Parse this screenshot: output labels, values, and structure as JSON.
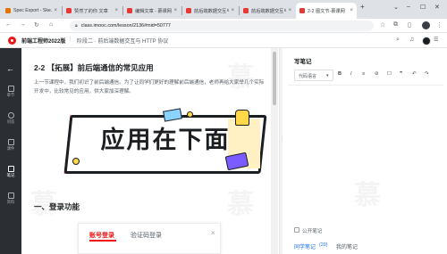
{
  "tabs": [
    {
      "title": "Spec Export - Ske…",
      "active": false,
      "favicon_color": "#e37400"
    },
    {
      "title": "赞然了的你 文章",
      "active": false,
      "favicon_color": "#e53935"
    },
    {
      "title": "编辑文章 - 慕课网",
      "active": false,
      "favicon_color": "#e53935"
    },
    {
      "title": "前后端数据交互与",
      "active": false,
      "favicon_color": "#e53935"
    },
    {
      "title": "前后端数据交互与",
      "active": false,
      "favicon_color": "#e53935"
    },
    {
      "title": "2-2 图文节-慕课网",
      "active": true,
      "favicon_color": "#e53935"
    }
  ],
  "address": {
    "url": "class.imooc.com/lesson/2136#mid=50777"
  },
  "crumbs": {
    "course": "前端工程师2022版",
    "sep": "|",
    "stage": "阶段二 · 前后端数据交互与 HTTP 协议"
  },
  "rail": [
    {
      "label": "章节",
      "icon": "list-icon"
    },
    {
      "label": "问答",
      "icon": "question-icon"
    },
    {
      "label": "课件",
      "icon": "file-icon"
    },
    {
      "label": "笔记",
      "icon": "edit-icon",
      "selected": true
    },
    {
      "label": "资料",
      "icon": "folder-icon"
    }
  ],
  "article": {
    "heading": "2-2 【拓展】前后端通信的常见应用",
    "paragraph": "上一节课程中，我们初识了前后端通信。为了让同学们更好的理解前后端通信，老师再给大家举几个实际开发中，比较常见的应用。供大家加深理解。",
    "banner_text": "应用在下面",
    "section1": "一、登录功能",
    "login_tabs": [
      "账号登录",
      "验证码登录"
    ],
    "close": "×"
  },
  "notes": {
    "title": "写笔记",
    "toolbar": [
      "代码语言",
      "B",
      "I",
      "≡",
      "⊘",
      "☐",
      "❞",
      "↶",
      "↷"
    ],
    "code_lang_arrow": "▾",
    "public_label": "公开笔记",
    "tab_classmates": "同学笔记",
    "classmates_count": "(20)",
    "tab_mine": "我的笔记"
  },
  "colors": {
    "brand_red": "#f01414",
    "rail": "#2b2e33",
    "link_blue": "#1a73e8",
    "active_tab": "#ffffff"
  }
}
